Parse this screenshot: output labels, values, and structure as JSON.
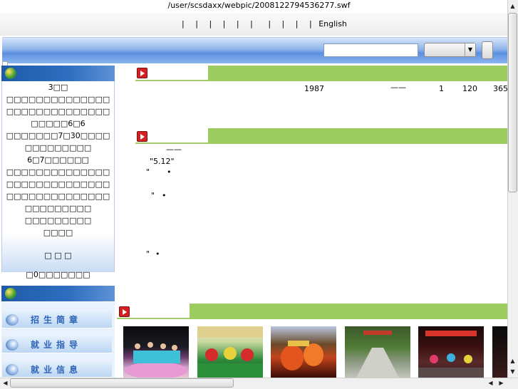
{
  "window": {
    "path": "/user/scsdaxx/webpic/2008122794536277.swf"
  },
  "topnav": {
    "separators": [
      "|",
      "|",
      "|",
      "|",
      "|",
      "|",
      "|",
      "|",
      "|",
      "|"
    ],
    "english": "English"
  },
  "search": {
    "value": "",
    "select_value": ""
  },
  "notice": {
    "lines": [
      "3□□",
      "□□□□□□□□□□□□□□□□□□□□□□□□□□□□□□□□□6□6",
      "□□□□□□□7□30□□□□□□□□□□□□□",
      "6□7□□□□□□",
      "□□□□□□□□□□□□□□□□□□□□□□□□□□□□□□□□□□□□□□□□□□□□□□□□□□□",
      "□□□□□□□□□",
      "□□□□",
      "□  □  □",
      "□0□□□□□□□"
    ]
  },
  "menu": {
    "items": [
      {
        "label": "招生简章"
      },
      {
        "label": "就业指导"
      },
      {
        "label": "就业信息"
      }
    ]
  },
  "intro": {
    "numbers": [
      "1987",
      "——",
      "1",
      "120",
      "365"
    ]
  },
  "news": {
    "dash": "——",
    "line1": "\"5.12\"",
    "quote_marks": [
      "\"",
      "•",
      "\"",
      "•",
      "\"",
      "•"
    ]
  },
  "colors": {
    "accent_green": "#9ccc60",
    "header_blue": "#1e5aa8",
    "menu_text": "#2d64b6",
    "section_red": "#d42020"
  }
}
